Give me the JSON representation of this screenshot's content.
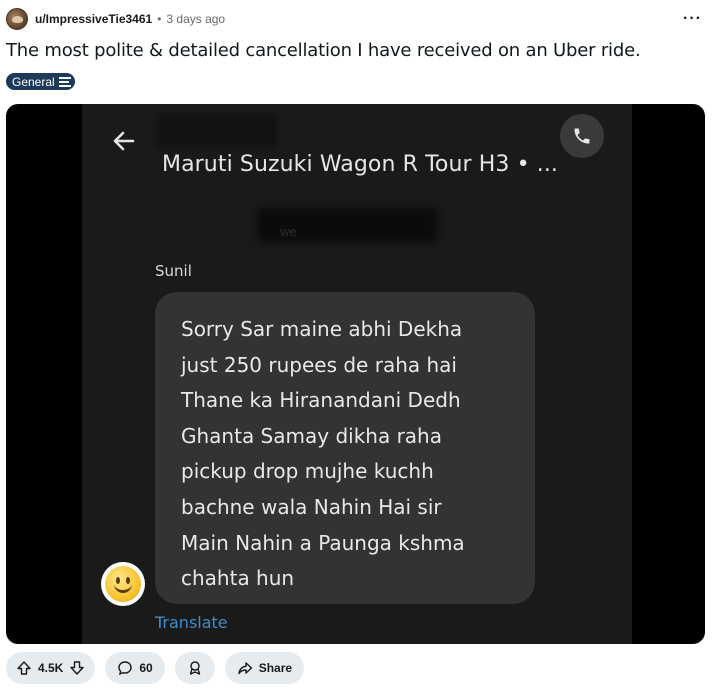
{
  "post": {
    "username": "u/ImpressiveTie3461",
    "separator": "•",
    "time": "3 days ago",
    "more": "···",
    "title": "The most polite & detailed cancellation I have received on an Uber ride.",
    "flair": "General"
  },
  "screenshot": {
    "car_name": "Maruti Suzuki Wagon R Tour H3 • ...",
    "redacted_fragment": "we",
    "sender": "Sunil",
    "message_lines": [
      "Sorry Sar maine abhi Dekha",
      "just 250 rupees de raha hai",
      "Thane ka Hiranandani Dedh",
      "Ghanta Samay dikha raha",
      "pickup drop mujhe kuchh",
      "bachne wala Nahin Hai sir",
      "Main Nahin a Paunga kshma",
      "chahta hun"
    ],
    "translate": "Translate"
  },
  "actions": {
    "votes": "4.5K",
    "comments": "60",
    "share": "Share"
  },
  "icons": {
    "back": "arrow-left-icon",
    "call": "phone-icon",
    "upvote": "arrow-up-icon",
    "downvote": "arrow-down-icon",
    "comment": "comment-bubble-icon",
    "award": "award-icon",
    "share": "share-arrow-icon"
  },
  "colors": {
    "flair_bg": "#1d3a5a",
    "bubble_bg": "#333333",
    "translate_link": "#3d8ec9",
    "action_pill_bg": "#e5ebee"
  }
}
